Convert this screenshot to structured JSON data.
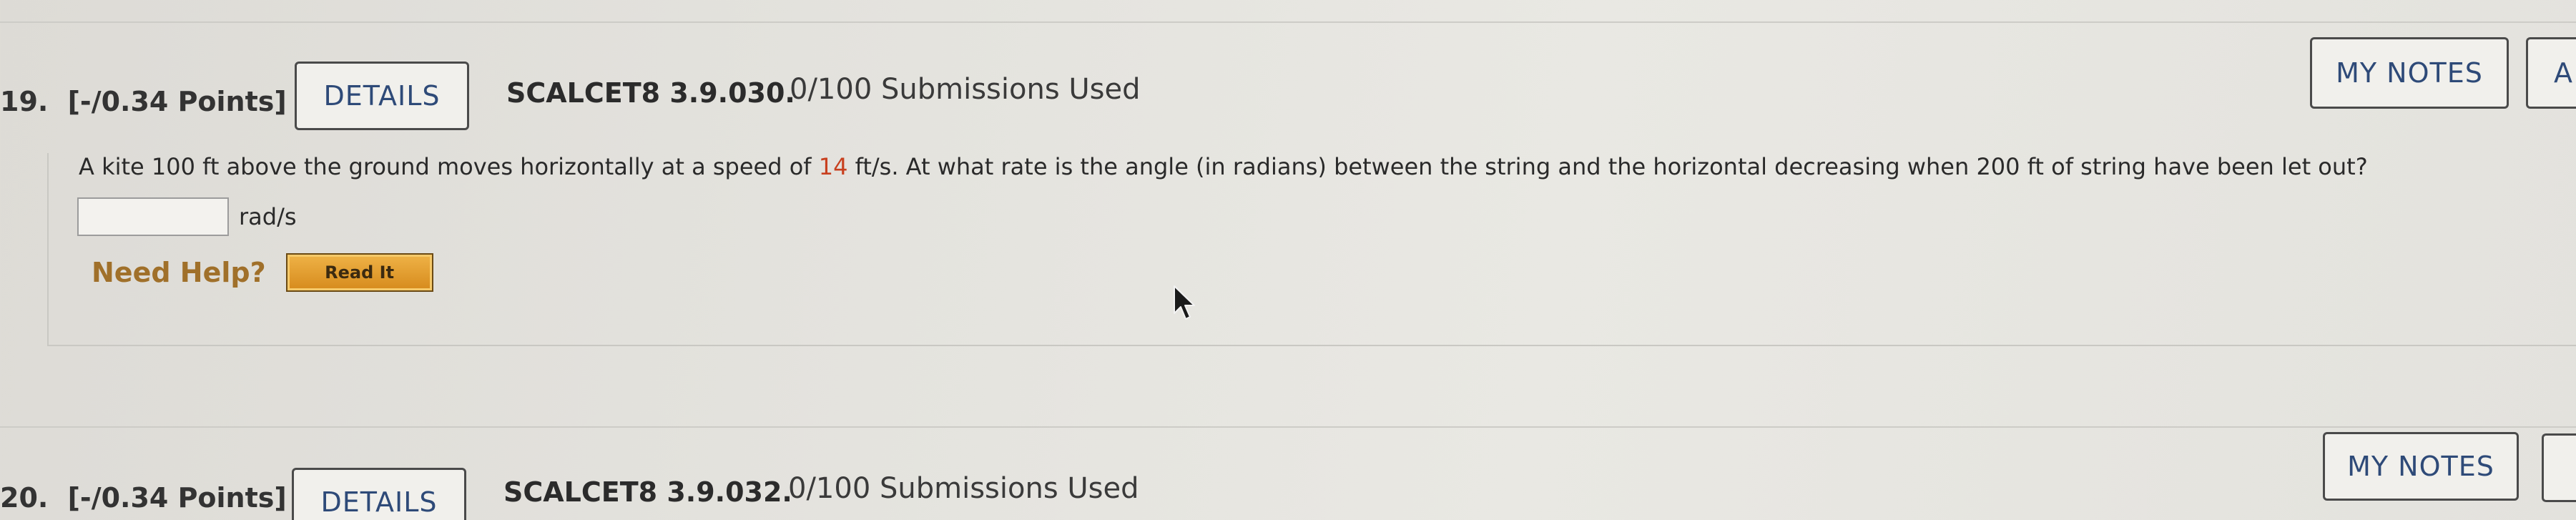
{
  "questions": [
    {
      "number": "19.",
      "points": "[-/0.34 Points]",
      "details_label": "DETAILS",
      "code": "SCALCET8 3.9.030.",
      "submissions": "0/100 Submissions Used",
      "my_notes_label": "MY NOTES",
      "extra_label": "A",
      "text_before": "A kite 100 ft above the ground moves horizontally at a speed of ",
      "text_highlight": "14",
      "text_after": " ft/s. At what rate is the angle (in radians) between the string and the horizontal decreasing when 200 ft of string have been let out?",
      "answer_value": "",
      "unit": "rad/s",
      "need_help": "Need Help?",
      "read_it": "Read It"
    },
    {
      "number": "20.",
      "points": "[-/0.34 Points]",
      "details_label": "DETAILS",
      "code": "SCALCET8 3.9.032.",
      "submissions": "0/100 Submissions Used",
      "my_notes_label": "MY NOTES"
    }
  ],
  "colors": {
    "highlight": "#c8401f",
    "link_blue": "#2e4a78",
    "help_gold": "#a0702a",
    "read_it_orange": "#d68a1c"
  },
  "icons": {
    "cursor": "mouse-pointer-icon"
  }
}
